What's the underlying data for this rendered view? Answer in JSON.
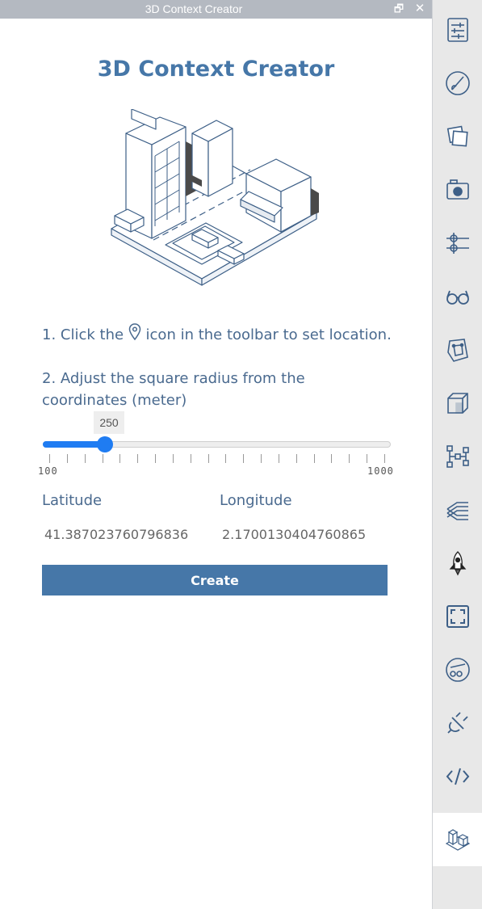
{
  "window": {
    "title": "3D Context Creator",
    "restore_glyph": "🗗",
    "close_glyph": "✕"
  },
  "panel": {
    "heading": "3D Context Creator",
    "step1_before": "1. Click the",
    "step1_after": "icon in the toolbar to set location.",
    "step2": "2. Adjust the square radius from the coordinates (meter)"
  },
  "slider": {
    "value": 250,
    "min": 100,
    "max": 1000,
    "min_label": "100",
    "max_label": "1000",
    "tick_count": 20,
    "color": "#1f7cf2"
  },
  "coordinates": {
    "latitude_label": "Latitude",
    "longitude_label": "Longitude",
    "latitude_value": "41.387023760796836",
    "longitude_value": "2.1700130404760865"
  },
  "actions": {
    "create_label": "Create"
  },
  "toolbar": {
    "items": [
      {
        "name": "settings-sliders-icon"
      },
      {
        "name": "paint-brush-icon"
      },
      {
        "name": "layers-icon"
      },
      {
        "name": "camera-icon"
      },
      {
        "name": "axis-crosshair-icon"
      },
      {
        "name": "glasses-icon"
      },
      {
        "name": "mesh-object-icon"
      },
      {
        "name": "cube-icon"
      },
      {
        "name": "tree-graph-icon"
      },
      {
        "name": "layer-stack-icon"
      },
      {
        "name": "rocket-icon"
      },
      {
        "name": "fullscreen-icon"
      },
      {
        "name": "measure-gauge-icon"
      },
      {
        "name": "plug-icon"
      },
      {
        "name": "code-icon"
      },
      {
        "name": "city-context-icon",
        "active": true
      }
    ]
  },
  "colors": {
    "accent": "#4677a8",
    "titlebar": "#b4b9c1",
    "toolbar_bg": "#e8e8e8"
  }
}
